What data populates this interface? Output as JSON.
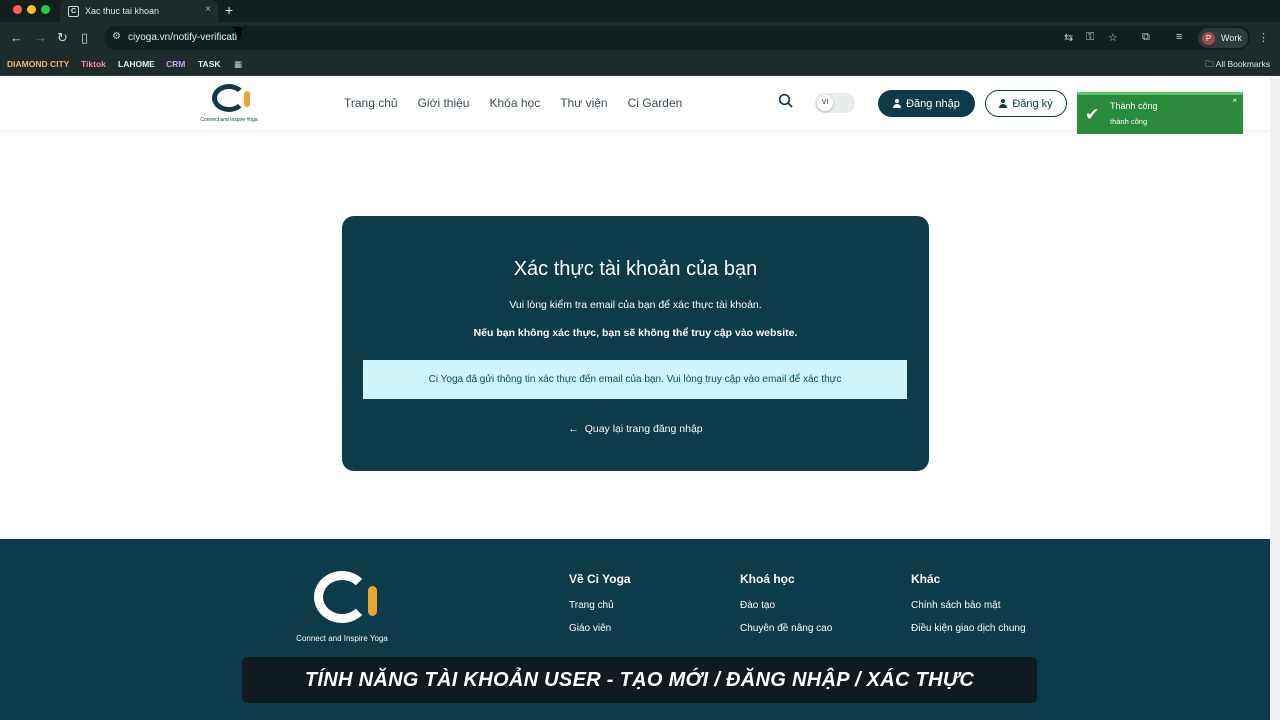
{
  "browser": {
    "tab_title": "Xac thuc tai khoan",
    "tab_close": "×",
    "new_tab": "+",
    "url": "ciyoga.vn/notify-verificati",
    "profile_initial": "P",
    "profile_label": "Work",
    "bookmarks": [
      {
        "label": "DIAMOND CITY",
        "color": "#f0b27a"
      },
      {
        "label": "Tiktok",
        "color": "#f28b9b"
      },
      {
        "label": "LAHOME",
        "color": "#e6ecec"
      },
      {
        "label": "CRM",
        "color": "#c9a5f0"
      },
      {
        "label": "TASK",
        "color": "#e6ecec"
      }
    ],
    "all_bookmarks": "All Bookmarks"
  },
  "site": {
    "logo_tag": "Connect and Inspire Yoga",
    "nav": [
      "Trang chủ",
      "Giới thiệu",
      "Khóa học",
      "Thư viện",
      "Ci Garden"
    ],
    "lang": "VI",
    "login_label": "Đăng nhập",
    "register_label": "Đăng ký",
    "brand_color": "#0d3b4a",
    "accent_color": "#e8a531"
  },
  "toast": {
    "title": "Thành công",
    "message": "thành công",
    "close": "×"
  },
  "card": {
    "title": "Xác thực tài khoản của bạn",
    "subtitle": "Vui lòng kiểm tra email của bạn để xác thực tài khoản.",
    "warning": "Nếu bạn không xác thực, bạn sẽ không thể truy cập vào website.",
    "notice": "Ci Yoga đã gửi thông tin xác thực đến email của bạn. Vui lòng truy cập vào email để xác thực",
    "back_link": "Quay lại trang đăng nhập"
  },
  "footer": {
    "logo_tag": "Connect and Inspire Yoga",
    "columns": [
      {
        "heading": "Về Ci Yoga",
        "links": [
          "Trang chủ",
          "Giáo viên"
        ]
      },
      {
        "heading": "Khoá học",
        "links": [
          "Đào tạo",
          "Chuyên đề nâng cao"
        ]
      },
      {
        "heading": "Khác",
        "links": [
          "Chính sách bảo mật",
          "Điều kiện giao dịch chung"
        ]
      }
    ]
  },
  "caption": "TÍNH NĂNG TÀI KHOẢN USER - TẠO MỚI / ĐĂNG NHẬP / XÁC THỰC"
}
